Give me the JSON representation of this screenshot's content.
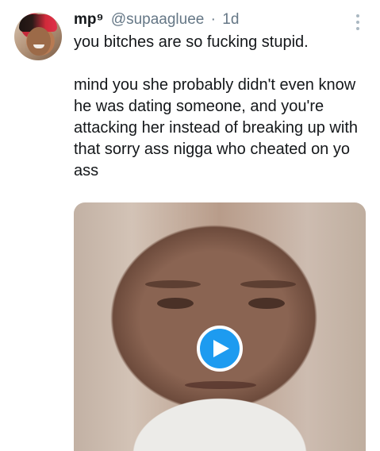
{
  "tweet": {
    "display_name": "mp⁹",
    "handle": "@supaagluee",
    "separator": "·",
    "timestamp": "1d",
    "paragraphs": [
      "you bitches are so fucking stupid.",
      "mind you she probably didn't even know he was dating someone, and you're attacking her instead of breaking up with that sorry ass nigga who cheated on yo ass"
    ],
    "icons": {
      "more": "more-vertical-icon",
      "play": "play-icon"
    }
  },
  "colors": {
    "name": "#14171a",
    "secondary": "#657786",
    "accent": "#1d9bf0"
  }
}
